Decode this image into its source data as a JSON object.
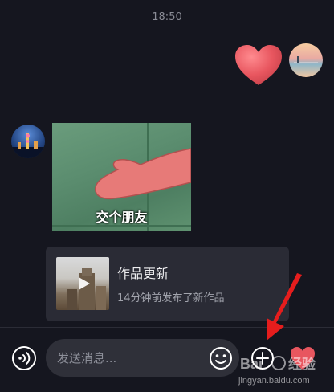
{
  "chat": {
    "timestamp": "18:50",
    "meme_caption": "交个朋友"
  },
  "share_card": {
    "title": "作品更新",
    "subtitle": "14分钟前发布了新作品"
  },
  "composer": {
    "placeholder": "发送消息..."
  },
  "watermark": {
    "line1": "Bai",
    "line1_cn": "经验",
    "line2": "jingyan.baidu.com"
  },
  "colors": {
    "background": "#15161f",
    "card": "#2a2b35",
    "input": "#2f3039",
    "heart": "#e8565f",
    "arrow": "#e51d1d"
  },
  "icons": [
    "heart-sticker",
    "voice-icon",
    "emoji-icon",
    "plus-icon",
    "heart-icon",
    "play-icon"
  ]
}
